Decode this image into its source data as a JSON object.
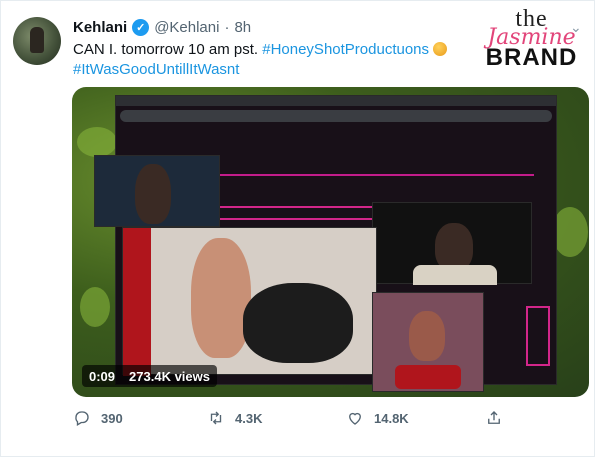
{
  "tweet": {
    "name": "Kehlani",
    "handle": "@Kehlani",
    "separator": "·",
    "time": "8h",
    "text_line1": "CAN I. tomorrow 10 am pst.",
    "hashtag1": "#HoneyShotProductuons",
    "hashtag2": "#ItWasGoodUntillItWasnt"
  },
  "watermark": {
    "the": "the",
    "jasmine": "Jasmine",
    "brand": "BRAND"
  },
  "media": {
    "duration": "0:09",
    "views": "273.4K views"
  },
  "actions": {
    "replies": "390",
    "retweets": "4.3K",
    "likes": "14.8K"
  },
  "colors": {
    "link": "#1b95e0",
    "verified": "#1d9bf0",
    "muted": "#536471"
  }
}
